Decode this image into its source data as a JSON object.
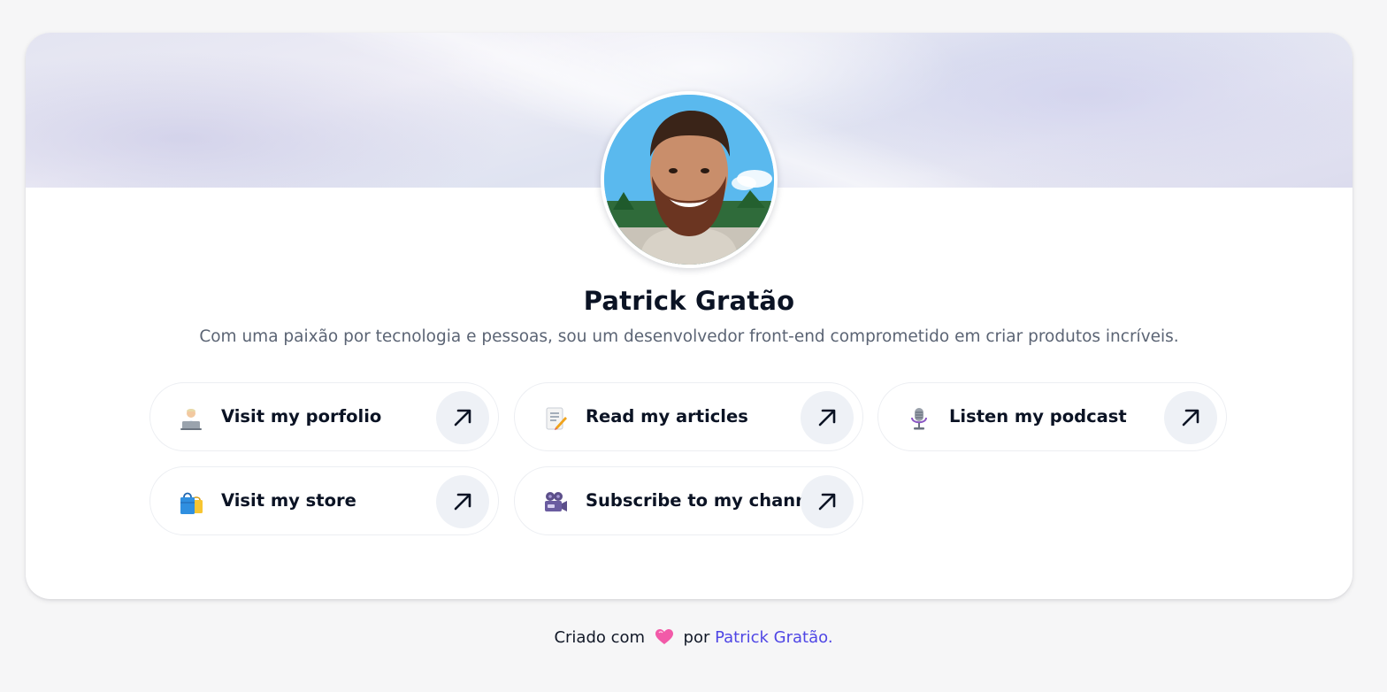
{
  "profile": {
    "name": "Patrick Gratão",
    "bio": "Com uma paixão por tecnologia e pessoas, sou um desenvolvedor front-end comprometido em criar produtos incríveis."
  },
  "links": [
    {
      "label": "Visit my porfolio",
      "icon": "technologist-emoji-icon"
    },
    {
      "label": "Read my articles",
      "icon": "memo-emoji-icon"
    },
    {
      "label": "Listen my podcast",
      "icon": "microphone-emoji-icon"
    },
    {
      "label": "Visit my store",
      "icon": "shopping-bags-emoji-icon"
    },
    {
      "label": "Subscribe to my channel",
      "icon": "movie-camera-emoji-icon"
    }
  ],
  "footer": {
    "prefix": "Criado com",
    "middle": "por",
    "author": "Patrick Gratão."
  },
  "colors": {
    "accent": "#4f46e5",
    "arrow_bg": "#eef1f6",
    "page_bg": "#f6f6f7"
  }
}
